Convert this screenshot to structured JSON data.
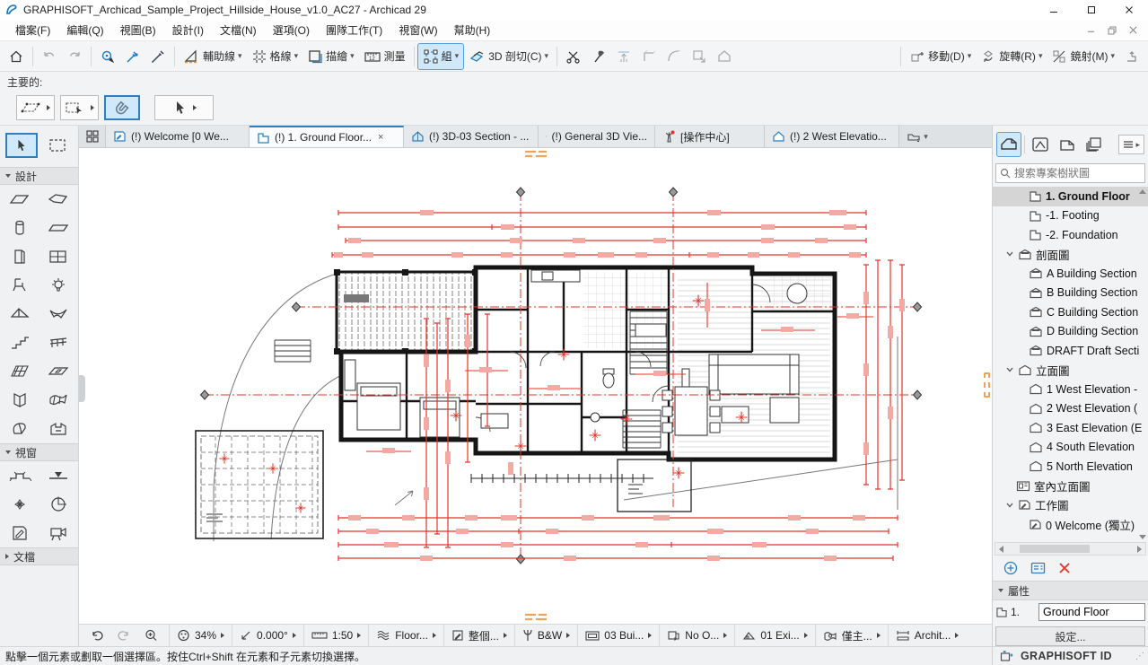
{
  "window": {
    "title": "GRAPHISOFT_Archicad_Sample_Project_Hillside_House_v1.0_AC27 - Archicad 29"
  },
  "menu": {
    "items": [
      {
        "label": "檔案(F)"
      },
      {
        "label": "編輯(Q)"
      },
      {
        "label": "視圖(B)"
      },
      {
        "label": "設計(I)"
      },
      {
        "label": "文檔(N)"
      },
      {
        "label": "選項(O)"
      },
      {
        "label": "團隊工作(T)"
      },
      {
        "label": "視窗(W)"
      },
      {
        "label": "幫助(H)"
      }
    ]
  },
  "toolbar": {
    "guide_lines": "輔助線",
    "grid": "格線",
    "trace": "描繪",
    "measure": "測量",
    "group": "組",
    "cutaway": "3D 剖切(C)",
    "move": "移動(D)",
    "rotate": "旋轉(R)",
    "mirror": "鏡射(M)"
  },
  "context_label": "主要的:",
  "tabs": [
    {
      "label": "(!) Welcome [0 We..."
    },
    {
      "label": "(!) 1. Ground Floor...",
      "close": "×"
    },
    {
      "label": "(!) 3D-03 Section - ..."
    },
    {
      "label": "(!) General 3D Vie..."
    },
    {
      "label": "[操作中心]"
    },
    {
      "label": "(!) 2 West Elevatio..."
    }
  ],
  "left_toolbox": {
    "sections": [
      {
        "label": "設計"
      },
      {
        "label": "視窗"
      },
      {
        "label": "文檔"
      }
    ]
  },
  "right_panel": {
    "search_placeholder": "搜索專案樹狀圖",
    "tree": [
      {
        "label": "1. Ground Floor",
        "selected": true
      },
      {
        "label": "-1. Footing"
      },
      {
        "label": "-2. Foundation"
      },
      {
        "label": "剖面圖",
        "folder": true
      },
      {
        "label": "A Building Section"
      },
      {
        "label": "B Building Section"
      },
      {
        "label": "C Building Section"
      },
      {
        "label": "D Building Section"
      },
      {
        "label": "DRAFT Draft Secti"
      },
      {
        "label": "立面圖",
        "folder": true
      },
      {
        "label": "1 West Elevation -"
      },
      {
        "label": "2 West Elevation ("
      },
      {
        "label": "3 East Elevation (E"
      },
      {
        "label": "4 South Elevation"
      },
      {
        "label": "5 North Elevation"
      },
      {
        "label": "室內立面圖"
      },
      {
        "label": "工作圖",
        "folder": true
      },
      {
        "label": "0 Welcome (獨立)"
      }
    ],
    "properties_header": "屬性",
    "story_prefix": "1.",
    "story_name": "Ground Floor",
    "settings_label": "設定...",
    "graphisoft_id": "GRAPHISOFT ID"
  },
  "quick_options": [
    {
      "label": "34%"
    },
    {
      "label": "0.000°"
    },
    {
      "label": "1:50"
    },
    {
      "label": "Floor..."
    },
    {
      "label": "整個..."
    },
    {
      "label": "B&W"
    },
    {
      "label": "03 Bui..."
    },
    {
      "label": "No O..."
    },
    {
      "label": "01 Exi..."
    },
    {
      "label": "僅主..."
    },
    {
      "label": "Archit..."
    }
  ],
  "status": {
    "message": "點擊一個元素或劃取一個選擇區。按住Ctrl+Shift 在元素和子元素切換選擇。"
  },
  "colors": {
    "accent_blue": "#2d7fc1",
    "dimension_red": "#e5332a",
    "selection_highlight": "#cfe8fa"
  }
}
